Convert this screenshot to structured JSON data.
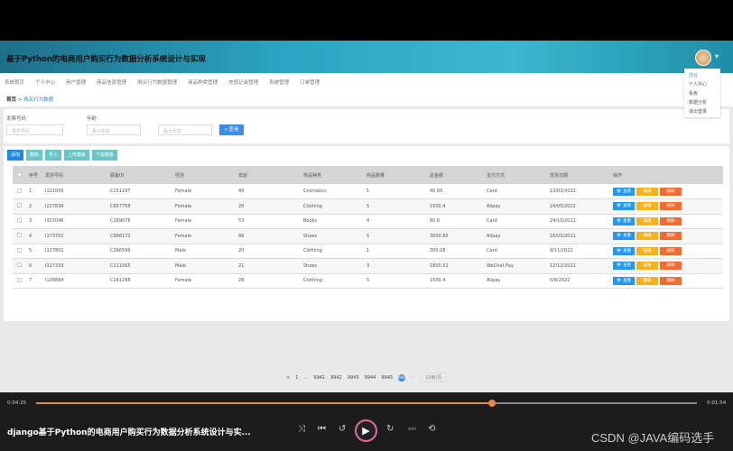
{
  "header": {
    "title": "基于Python的电商用户购买行为数据分析系统设计与实现"
  },
  "nav": [
    "系统首页",
    "个人中心",
    "用户管理",
    "商品信息管理",
    "购买行为数据管理",
    "商品种类管理",
    "充值记录管理",
    "系统管理",
    "订单管理"
  ],
  "breadcrumb": {
    "home": "首页",
    "current": "购买行为数据"
  },
  "user_menu": [
    "前台",
    "个人中心",
    "看板",
    "数据分析",
    "退出登录"
  ],
  "search": {
    "invoice_label": "发票号码",
    "invoice_placeholder": "发票号码",
    "age_label": "年龄",
    "min_age_placeholder": "最小年龄",
    "max_age_placeholder": "最大年龄",
    "query": "查询"
  },
  "toolbar": {
    "add": "添加",
    "delete": "删除",
    "import": "导入",
    "upload_template": "上传模板",
    "download_template": "下载模板"
  },
  "colors": {
    "primary": "#3a8ee6",
    "teal": "#67c6c6",
    "view": "#2196f3",
    "edit": "#f7b21b",
    "delete": "#f46a2f"
  },
  "table": {
    "headers": [
      "序号",
      "发票号码",
      "顾客ID",
      "性别",
      "年龄",
      "商品种类",
      "商品数量",
      "总金额",
      "支付方式",
      "发票日期",
      "操作"
    ],
    "actions": {
      "view": "查看",
      "edit": "编辑",
      "delete": "删除"
    },
    "rows": [
      [
        "1",
        "I121056",
        "C151197",
        "Female",
        "49",
        "Cosmetics",
        "1",
        "40.66",
        "Card",
        "13/03/2022"
      ],
      [
        "2",
        "I227836",
        "C657758",
        "Female",
        "28",
        "Clothing",
        "5",
        "1500.4",
        "Alipay",
        "24/05/2022"
      ],
      [
        "3",
        "I337046",
        "C189076",
        "Female",
        "53",
        "Books",
        "4",
        "60.6",
        "Card",
        "24/10/2021"
      ],
      [
        "4",
        "I173702",
        "C988172",
        "Female",
        "66",
        "Shoes",
        "5",
        "3000.85",
        "Alipay",
        "16/05/2021"
      ],
      [
        "5",
        "I127801",
        "C266599",
        "Male",
        "20",
        "Clothing",
        "1",
        "300.08",
        "Card",
        "9/11/2021"
      ],
      [
        "6",
        "I317333",
        "C111565",
        "Male",
        "21",
        "Shoes",
        "3",
        "1800.51",
        "WeChat Pay",
        "12/12/2021"
      ],
      [
        "7",
        "I138884",
        "C241288",
        "Female",
        "28",
        "Clothing",
        "5",
        "1500.4",
        "Alipay",
        "5/8/2022"
      ]
    ]
  },
  "pagination": {
    "prev": "<",
    "first": "1",
    "ellipsis": "…",
    "pages": [
      "9941",
      "9942",
      "9943",
      "9944",
      "9945"
    ],
    "current": "9946",
    "next": ">",
    "page_size": "10条/页"
  },
  "player": {
    "elapsed": "0:04:25",
    "remaining": "0:01:54",
    "progress": 0.69,
    "video_title": "django基于Python的电商用户购买行为数据分析系统设计与实...",
    "watermark": "CSDN @JAVA编码选手"
  }
}
